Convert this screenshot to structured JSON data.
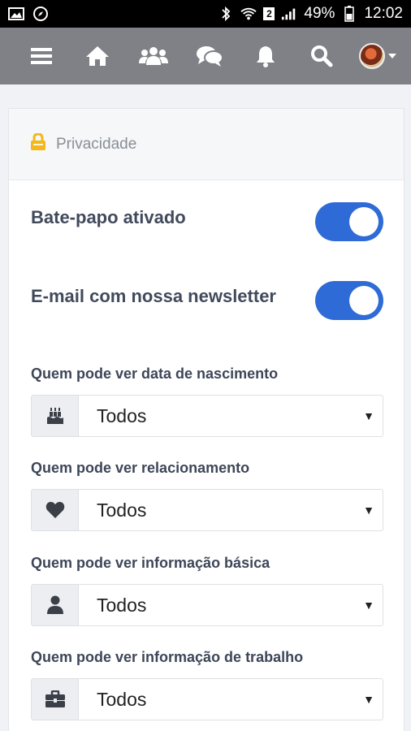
{
  "status_bar": {
    "battery": "49%",
    "time": "12:02",
    "sim_badge": "2"
  },
  "nav": {
    "items": [
      "menu-icon",
      "home-icon",
      "users-icon",
      "chat-icon",
      "bell-icon",
      "search-icon",
      "avatar"
    ]
  },
  "section": {
    "title": "Privacidade"
  },
  "toggles": [
    {
      "label": "Bate-papo ativado",
      "on": true
    },
    {
      "label": "E-mail com nossa newsletter",
      "on": true
    }
  ],
  "fields": [
    {
      "label": "Quem pode ver data de nascimento",
      "value": "Todos",
      "icon": "cake-icon"
    },
    {
      "label": "Quem pode ver relacionamento",
      "value": "Todos",
      "icon": "heart-icon"
    },
    {
      "label": "Quem pode ver informação básica",
      "value": "Todos",
      "icon": "user-icon"
    },
    {
      "label": "Quem pode ver informação de trabalho",
      "value": "Todos",
      "icon": "briefcase-icon"
    }
  ],
  "colors": {
    "accent": "#2f6bd6",
    "nav_bg": "#7f8186",
    "lock_icon": "#f2b81c"
  }
}
